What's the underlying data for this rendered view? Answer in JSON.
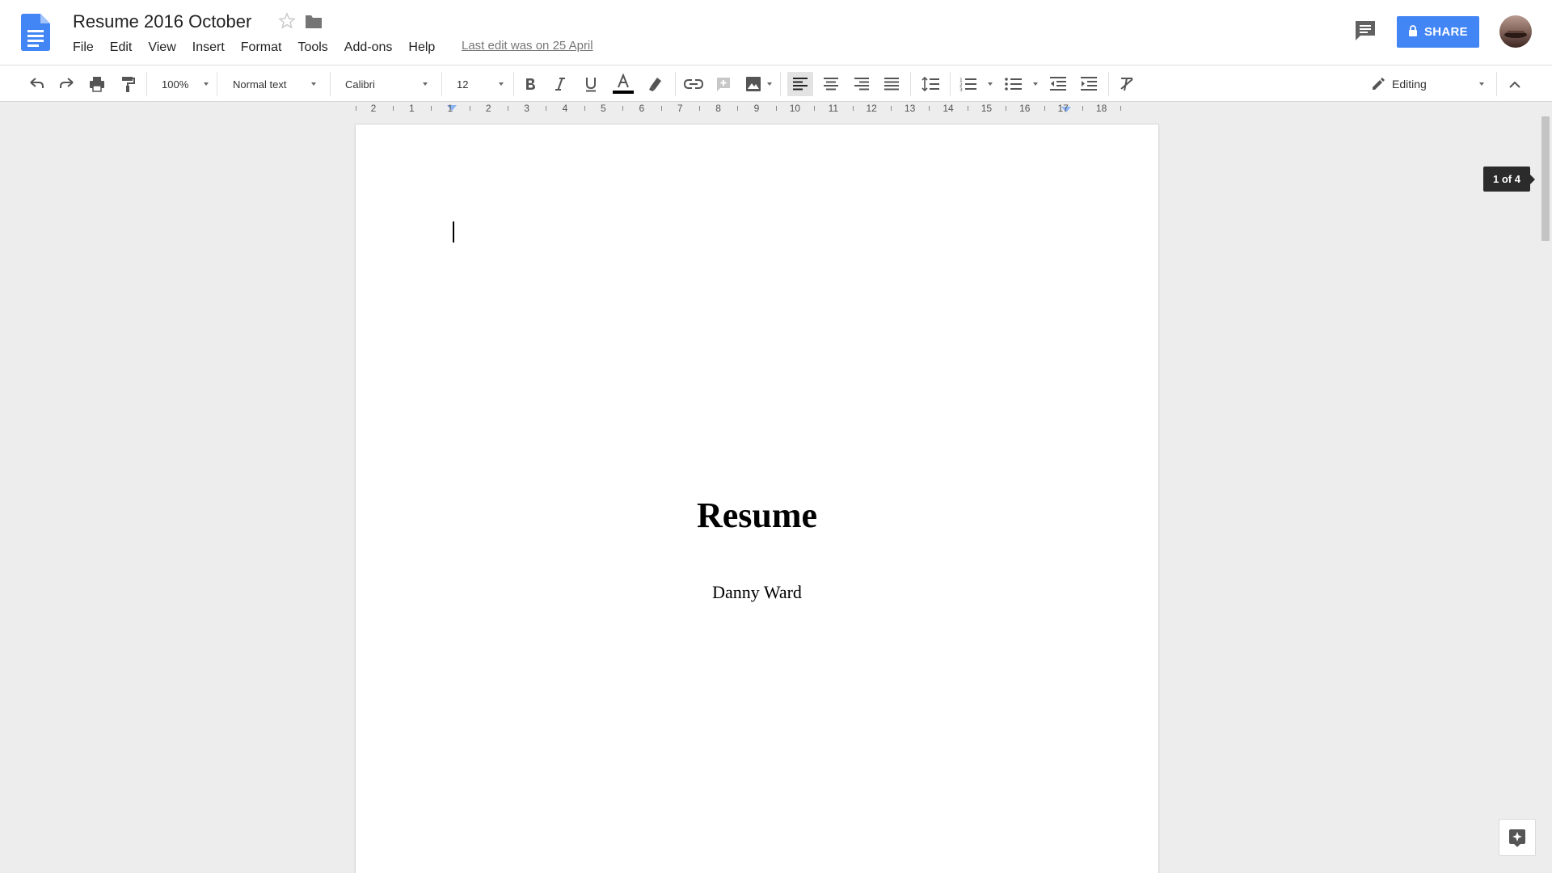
{
  "app": {
    "title": "Resume 2016 October",
    "last_edit": "Last edit was on 25 April",
    "share_label": "SHARE"
  },
  "menu": {
    "items": [
      {
        "label": "File"
      },
      {
        "label": "Edit"
      },
      {
        "label": "View"
      },
      {
        "label": "Insert"
      },
      {
        "label": "Format"
      },
      {
        "label": "Tools"
      },
      {
        "label": "Add-ons"
      },
      {
        "label": "Help"
      }
    ]
  },
  "toolbar": {
    "zoom": "100%",
    "style": "Normal text",
    "font": "Calibri",
    "font_size": "12",
    "mode": "Editing",
    "text_color": "#000000"
  },
  "ruler": {
    "labels": [
      "2",
      "1",
      "1",
      "2",
      "3",
      "4",
      "5",
      "6",
      "7",
      "8",
      "9",
      "10",
      "11",
      "12",
      "13",
      "14",
      "15",
      "16",
      "17",
      "18"
    ]
  },
  "document": {
    "title": "Resume",
    "author": "Danny Ward"
  },
  "page_indicator": "1 of 4",
  "colors": {
    "accent": "#4285f4",
    "doc_icon": "#4285f4"
  },
  "icons": [
    "docs-logo-icon",
    "star-icon",
    "folder-icon",
    "comments-icon",
    "lock-icon",
    "avatar",
    "undo-icon",
    "redo-icon",
    "print-icon",
    "paint-format-icon",
    "bold-icon",
    "italic-icon",
    "underline-icon",
    "text-color-icon",
    "highlight-icon",
    "link-icon",
    "add-comment-icon",
    "image-icon",
    "align-left-icon",
    "align-center-icon",
    "align-right-icon",
    "align-justify-icon",
    "line-spacing-icon",
    "numbered-list-icon",
    "bulleted-list-icon",
    "decrease-indent-icon",
    "increase-indent-icon",
    "clear-formatting-icon",
    "pencil-icon",
    "collapse-icon",
    "explore-icon"
  ]
}
